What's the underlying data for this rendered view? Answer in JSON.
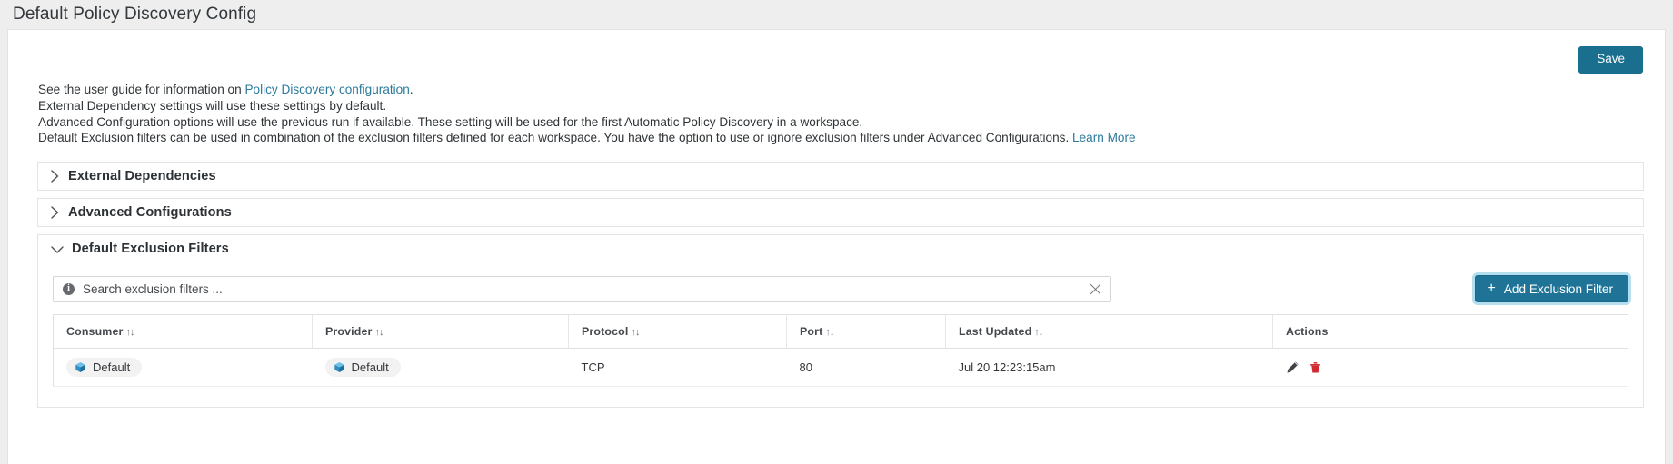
{
  "window": {
    "title": "Default Policy Discovery Config"
  },
  "toolbar": {
    "save_label": "Save"
  },
  "description": {
    "line1_pre": "See the user guide for information on ",
    "line1_link": "Policy Discovery configuration",
    "line1_post": ".",
    "line2": "External Dependency settings will use these settings by default.",
    "line3": "Advanced Configuration options will use the previous run if available. These setting will be used for the first Automatic Policy Discovery in a workspace.",
    "line4_pre": "Default Exclusion filters can be used in combination of the exclusion filters defined for each workspace. You have the option to use or ignore exclusion filters under Advanced Configurations. ",
    "line4_link": "Learn More"
  },
  "sections": [
    {
      "label": "External Dependencies",
      "expanded": false,
      "icon": "chevron-right-icon"
    },
    {
      "label": "Advanced Configurations",
      "expanded": false,
      "icon": "chevron-right-icon"
    },
    {
      "label": "Default Exclusion Filters",
      "expanded": true,
      "icon": "chevron-down-icon"
    }
  ],
  "exclusion_panel": {
    "search": {
      "value": "",
      "placeholder": "Search exclusion filters ...",
      "info_icon": "info-icon",
      "clear_icon": "close-icon"
    },
    "add_button": {
      "label": "Add Exclusion Filter",
      "icon": "plus-icon"
    },
    "table": {
      "columns": [
        {
          "label": "Consumer",
          "sortable": true,
          "sort_icon": "sort-arrows-icon"
        },
        {
          "label": "Provider",
          "sortable": true,
          "sort_icon": "sort-arrows-icon"
        },
        {
          "label": "Protocol",
          "sortable": true,
          "sort_icon": "sort-arrows-icon"
        },
        {
          "label": "Port",
          "sortable": true,
          "sort_icon": "sort-arrows-icon"
        },
        {
          "label": "Last Updated",
          "sortable": true,
          "sort_icon": "sort-arrows-icon"
        },
        {
          "label": "Actions",
          "sortable": false,
          "sort_icon": ""
        }
      ],
      "rows": [
        {
          "consumer": "Default",
          "provider": "Default",
          "protocol": "TCP",
          "port": "80",
          "last_updated": "Jul 20 12:23:15am",
          "actions": {
            "edit_icon": "pencil-icon",
            "delete_icon": "trash-icon"
          }
        }
      ]
    }
  },
  "colors": {
    "primary": "#1e7397",
    "save": "#1a6e8e",
    "link": "#2b7a9b",
    "delete": "#d0292f",
    "chip_icon": "#3a9bd5",
    "page_bg": "#eeeeee"
  }
}
